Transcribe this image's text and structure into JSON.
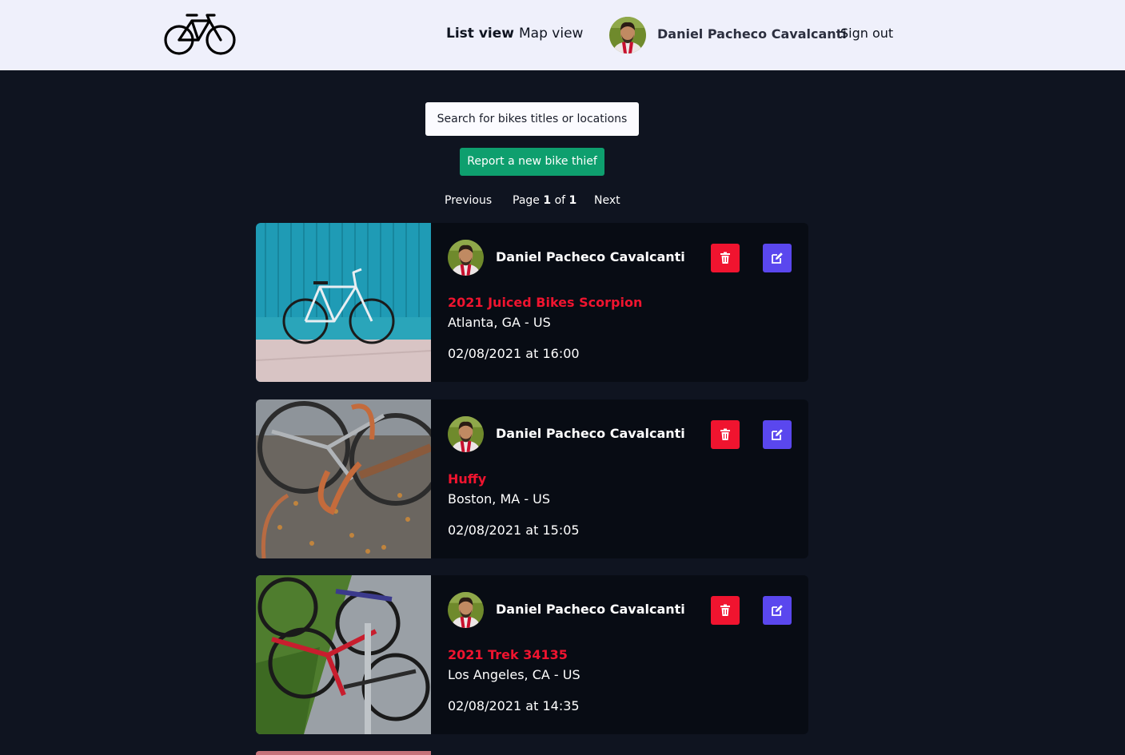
{
  "header": {
    "nav_list": "List view",
    "nav_map": "Map view",
    "user_name": "Daniel Pacheco Cavalcanti",
    "sign_out": "Sign out",
    "logo_icon": "bicycle-icon"
  },
  "search": {
    "placeholder": "Search for bikes titles or locations"
  },
  "report_button": "Report a new bike thief",
  "pagination": {
    "previous": "Previous",
    "page_label": "Page",
    "current": "1",
    "of_label": "of",
    "total": "1",
    "next": "Next"
  },
  "colors": {
    "accent_red": "#f0142f",
    "accent_purple": "#5a47ee",
    "accent_green": "#0e9f6e",
    "background": "#0f1420"
  },
  "cards": [
    {
      "user": "Daniel Pacheco Cavalcanti",
      "title": "2021 Juiced Bikes Scorpion",
      "location": "Atlanta, GA - US",
      "date": "02/08/2021 at 16:00"
    },
    {
      "user": "Daniel Pacheco Cavalcanti",
      "title": "Huffy",
      "location": "Boston, MA - US",
      "date": "02/08/2021 at 15:05"
    },
    {
      "user": "Daniel Pacheco Cavalcanti",
      "title": "2021 Trek 34135",
      "location": "Los Angeles, CA - US",
      "date": "02/08/2021 at 14:35"
    }
  ]
}
